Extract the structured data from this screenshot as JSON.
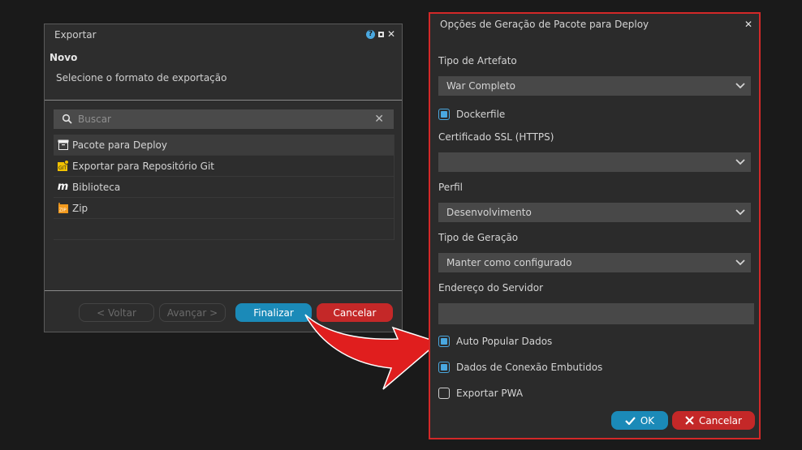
{
  "export_dialog": {
    "title": "Exportar",
    "subtitle": "Novo",
    "description": "Selecione o formato de exportação",
    "search": {
      "placeholder": "Buscar",
      "value": ""
    },
    "formats": [
      {
        "label": "Pacote para Deploy",
        "icon": "package-icon",
        "selected": true
      },
      {
        "label": "Exportar para Repositório Git",
        "icon": "git-icon",
        "selected": false
      },
      {
        "label": "Biblioteca",
        "icon": "library-icon",
        "selected": false
      },
      {
        "label": "Zip",
        "icon": "zip-icon",
        "selected": false
      }
    ],
    "buttons": {
      "back": "< Voltar",
      "next": "Avançar >",
      "finish": "Finalizar",
      "cancel": "Cancelar"
    }
  },
  "options_dialog": {
    "title": "Opções de Geração de Pacote para Deploy",
    "artifact_type": {
      "label": "Tipo de Artefato",
      "value": "War Completo"
    },
    "dockerfile": {
      "label": "Dockerfile",
      "checked": true
    },
    "ssl_certificate": {
      "label": "Certificado SSL (HTTPS)",
      "value": ""
    },
    "profile": {
      "label": "Perfil",
      "value": "Desenvolvimento"
    },
    "generation_type": {
      "label": "Tipo de Geração",
      "value": "Manter como configurado"
    },
    "server_address": {
      "label": "Endereço do Servidor",
      "value": ""
    },
    "auto_populate": {
      "label": "Auto Popular Dados",
      "checked": true
    },
    "embedded_connection": {
      "label": "Dados de Conexão Embutidos",
      "checked": true
    },
    "export_pwa": {
      "label": "Exportar PWA",
      "checked": false
    },
    "buttons": {
      "ok": "OK",
      "cancel": "Cancelar"
    }
  },
  "colors": {
    "accent_blue": "#1b8ab8",
    "danger_red": "#c42828",
    "highlight_border": "#d32828"
  }
}
